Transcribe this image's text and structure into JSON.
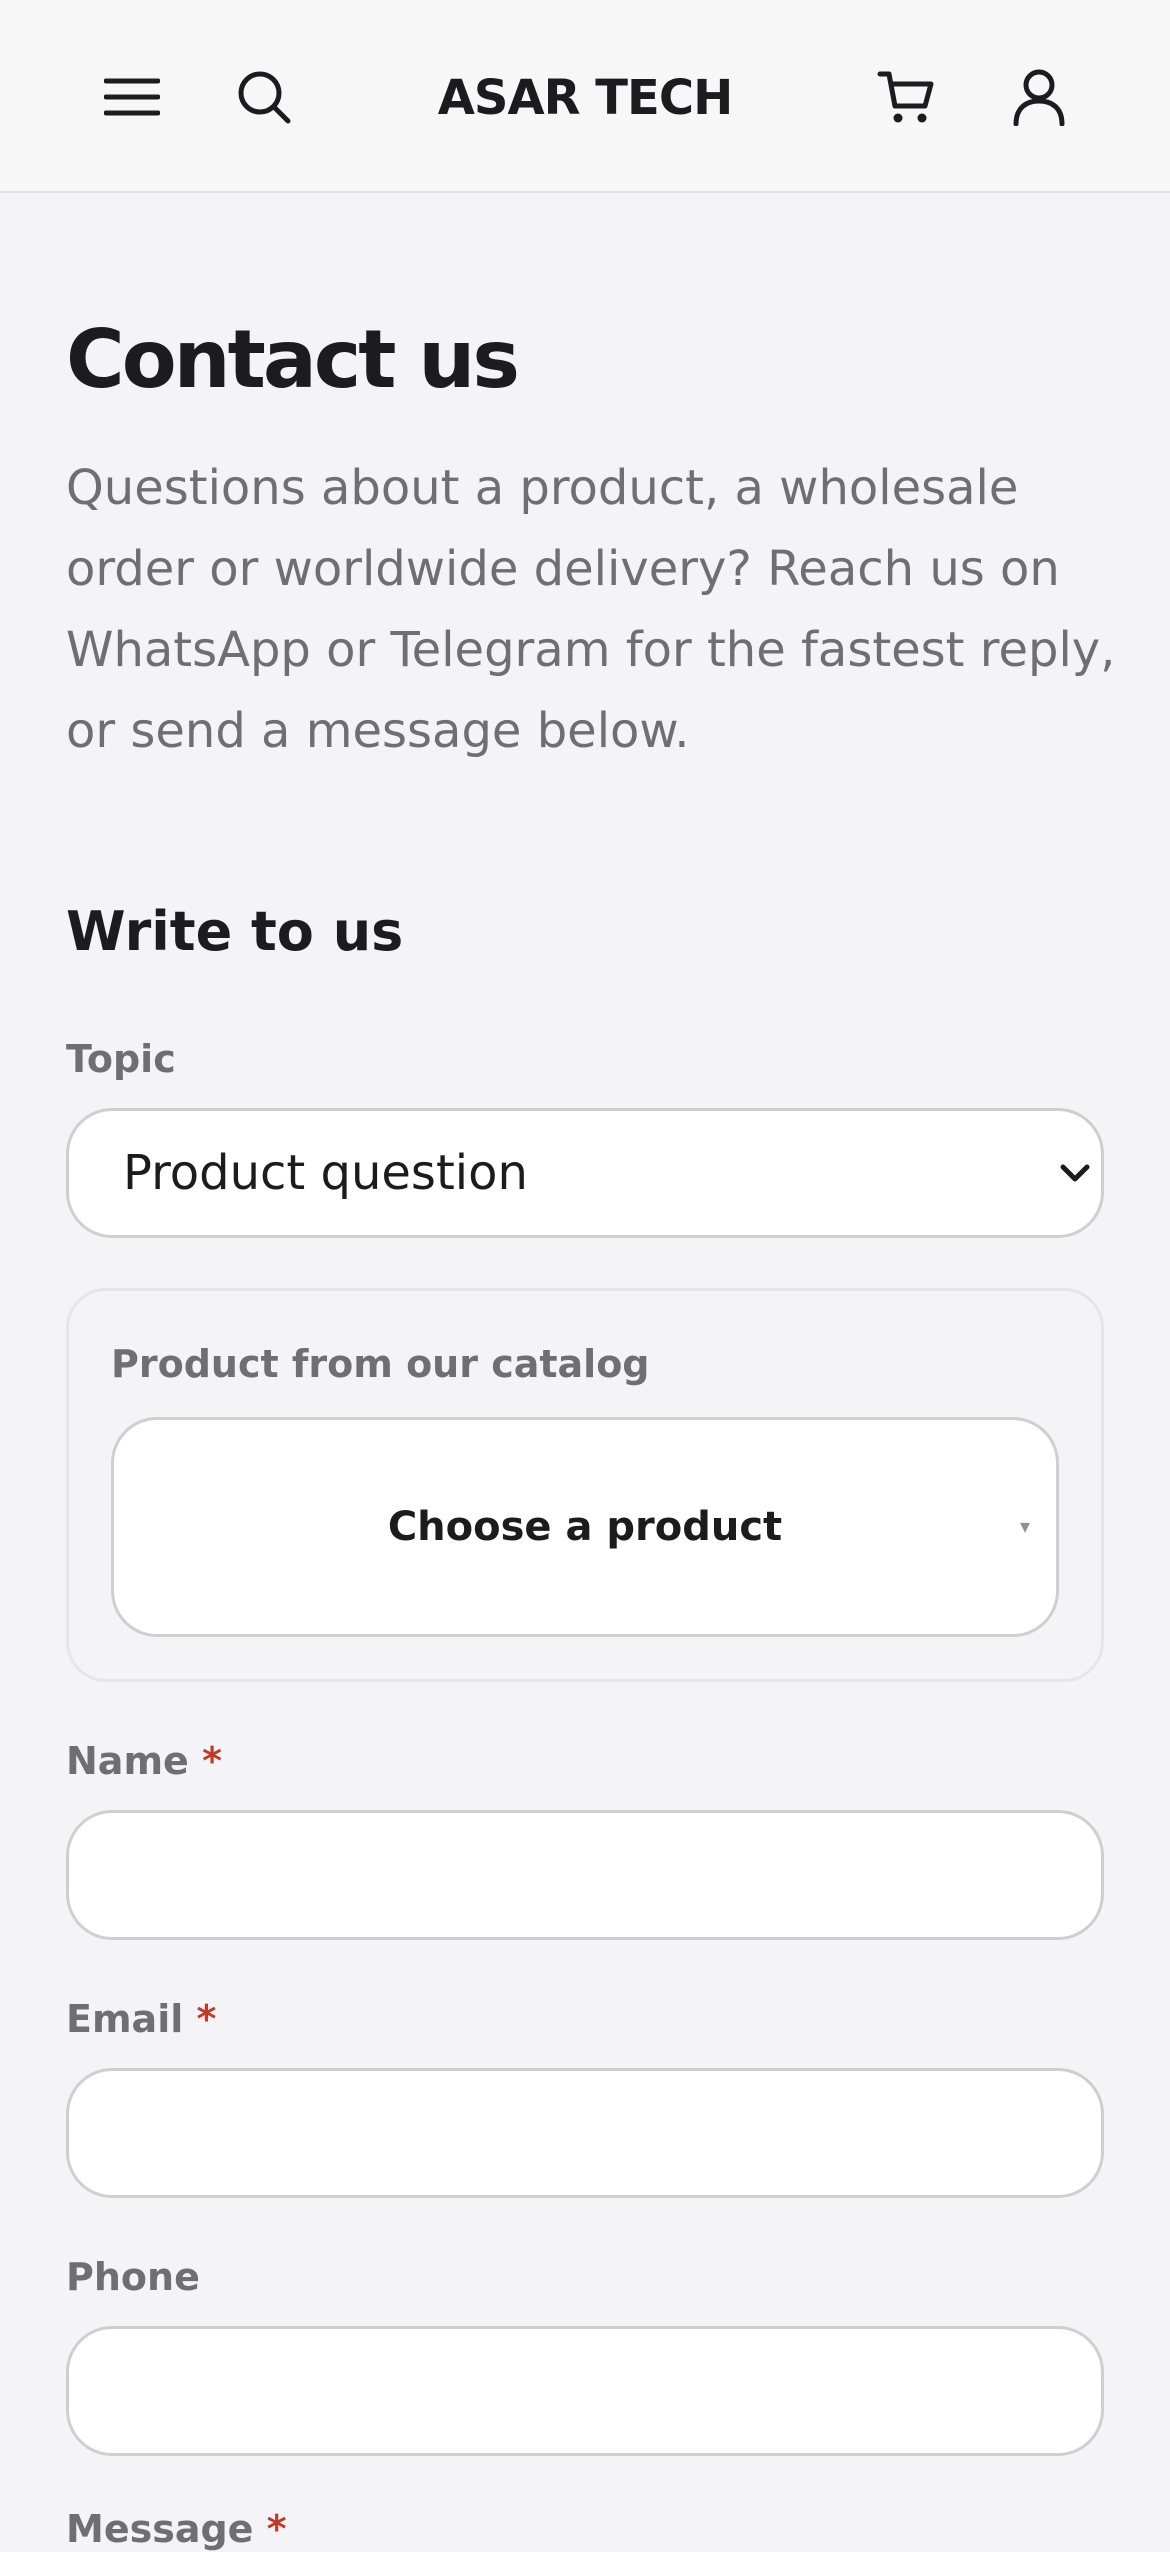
{
  "header": {
    "logo": "ASAR TECH",
    "icons": [
      "menu-icon",
      "search-icon",
      "cart-icon",
      "account-icon"
    ]
  },
  "page": {
    "title": "Contact us",
    "intro": "Questions about a product, a wholesale order or worldwide delivery? Reach us on WhatsApp or Telegram for the fastest reply, or send a message below."
  },
  "form": {
    "section_title": "Write to us",
    "topic": {
      "label": "Topic",
      "value": "Product question"
    },
    "catalog": {
      "label": "Product from our catalog",
      "placeholder": "Choose a product",
      "arrow": "▾"
    },
    "name": {
      "label": "Name",
      "required_mark": "*",
      "value": ""
    },
    "email": {
      "label": "Email",
      "required_mark": "*",
      "value": ""
    },
    "phone": {
      "label": "Phone",
      "value": ""
    },
    "message": {
      "label": "Message",
      "required_mark": "*"
    }
  },
  "colors": {
    "background": "#f4f4f6",
    "text": "#1c1c1e",
    "muted": "#6e6e73",
    "required": "#c0392b",
    "border": "#cfcfd3"
  }
}
